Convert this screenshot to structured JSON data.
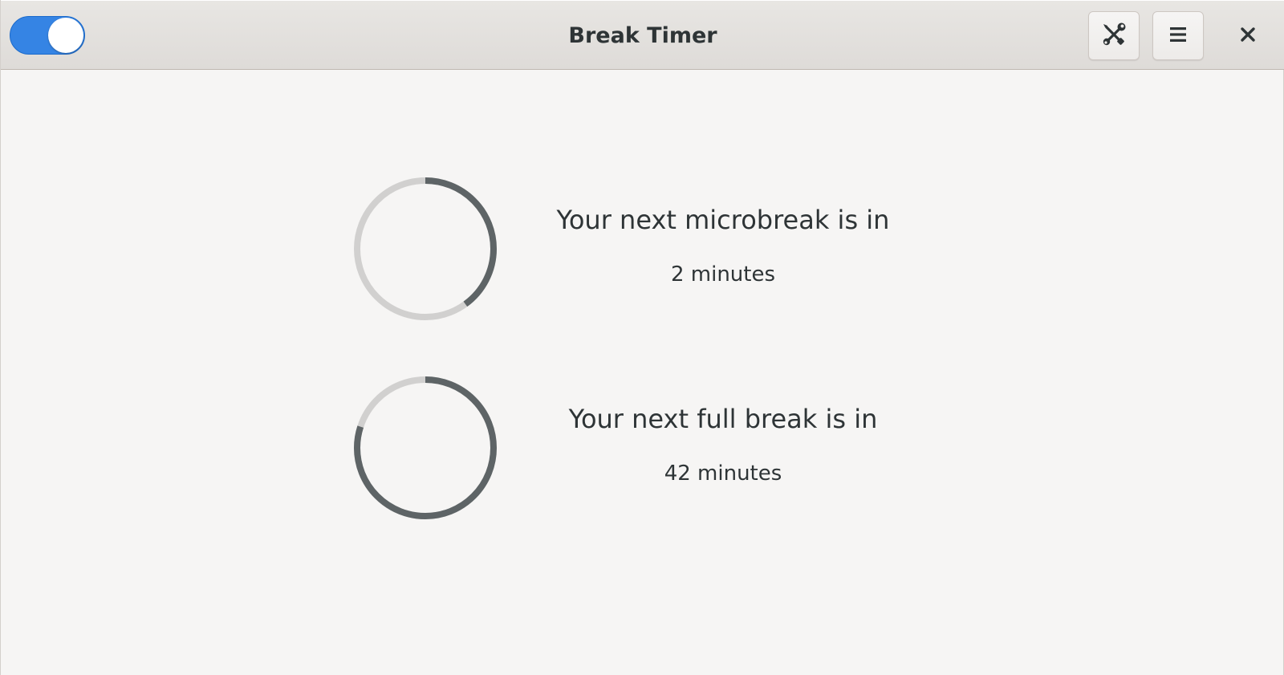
{
  "window": {
    "title": "Break Timer"
  },
  "header": {
    "master_switch_on": true,
    "tools_icon": "wrench-screwdriver-icon",
    "menu_icon": "hamburger-menu-icon",
    "close_icon": "close-icon"
  },
  "breaks": [
    {
      "heading": "Your next microbreak is in",
      "time_remaining": "2 minutes",
      "progress": 0.4
    },
    {
      "heading": "Your next full break is in",
      "time_remaining": "42 minutes",
      "progress": 0.8
    }
  ],
  "colors": {
    "accent": "#3584e4",
    "ring_active": "#5e6466",
    "ring_track": "#d1d0cf",
    "background": "#f6f5f4"
  }
}
